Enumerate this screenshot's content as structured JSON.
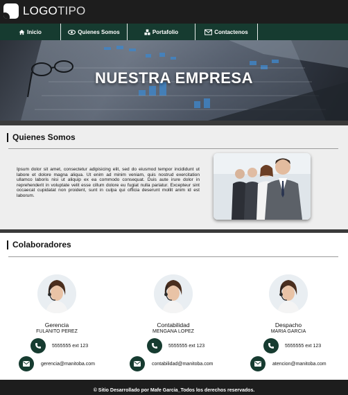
{
  "brand": {
    "logo_text_a": "LOGO",
    "logo_text_b": "TIPO"
  },
  "nav": {
    "items": [
      {
        "label": "Inicio",
        "icon": "home-icon"
      },
      {
        "label": "Quienes Somos",
        "icon": "eye-icon"
      },
      {
        "label": "Portafolio",
        "icon": "cubes-icon"
      },
      {
        "label": "Contactenos",
        "icon": "envelope-icon"
      }
    ]
  },
  "hero": {
    "title": "NUESTRA EMPRESA"
  },
  "about": {
    "title": "Quienes Somos",
    "text": "Ipsum dolor sit amet, consectetur adipisicing elit, sed do eiusmod tempor incididunt ut labore et dolore magna aliqua. Ut enim ad minim veniam, quis nostrud exercitation ullamco laboris nisi ut aliquip ex ea commodo consequat. Duis aute irure dolor in reprehenderit in voluptate velit esse cillum dolore eu fugiat nulla pariatur. Excepteur sint occaecat cupidatat non proident, sunt in culpa qui officia deserunt mollit anim id est laborum."
  },
  "collaborators": {
    "title": "Colaboradores",
    "people": [
      {
        "role": "Gerencia",
        "name": "FULANITO PEREZ",
        "phone": "5555555 ext 123",
        "email": "gerencia@manitoba.com"
      },
      {
        "role": "Contabilidad",
        "name": "MENGANA LOPEZ",
        "phone": "5555555 ext 123",
        "email": "contabilidad@manitoba.com"
      },
      {
        "role": "Despacho",
        "name": "MARIA GARCIA",
        "phone": "5555555 ext 123",
        "email": "atencion@manitoba.com"
      }
    ]
  },
  "footer": {
    "text": "© Sitio Desarrollado por Mafe Garcia_Todos los derechos reservados."
  },
  "colors": {
    "header_bg": "#1d1d1d",
    "nav_bg": "#163b30",
    "accent": "#163b30",
    "section_bg": "#eeeeee"
  }
}
